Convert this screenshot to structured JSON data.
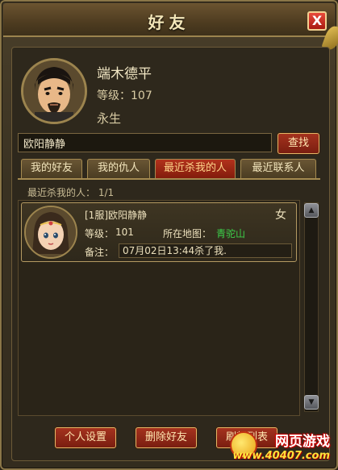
{
  "window": {
    "title": "好友",
    "close_label": "X"
  },
  "player": {
    "name": "端木德平",
    "level": "等级：107",
    "status": "永生"
  },
  "search": {
    "value": "欧阳静静",
    "button_label": "查找"
  },
  "tabs": [
    {
      "label": "我的好友",
      "active": false
    },
    {
      "label": "我的仇人",
      "active": false
    },
    {
      "label": "最近杀我的人",
      "active": true
    },
    {
      "label": "最近联系人",
      "active": false
    }
  ],
  "list": {
    "header": "最近杀我的人： 1/1",
    "entries": [
      {
        "name": "[1服]欧阳静静",
        "gender": "女",
        "level_label": "等级：",
        "level": "101",
        "map_label": "所在地图：",
        "map": "青驼山",
        "note_label": "备注：",
        "note": "07月02日13:44杀了我."
      }
    ]
  },
  "buttons": {
    "settings": "个人设置",
    "delete_friend": "删除好友",
    "refresh": "刷新列表"
  },
  "watermark": {
    "title": "网页游戏",
    "url": "www.40407.com"
  }
}
